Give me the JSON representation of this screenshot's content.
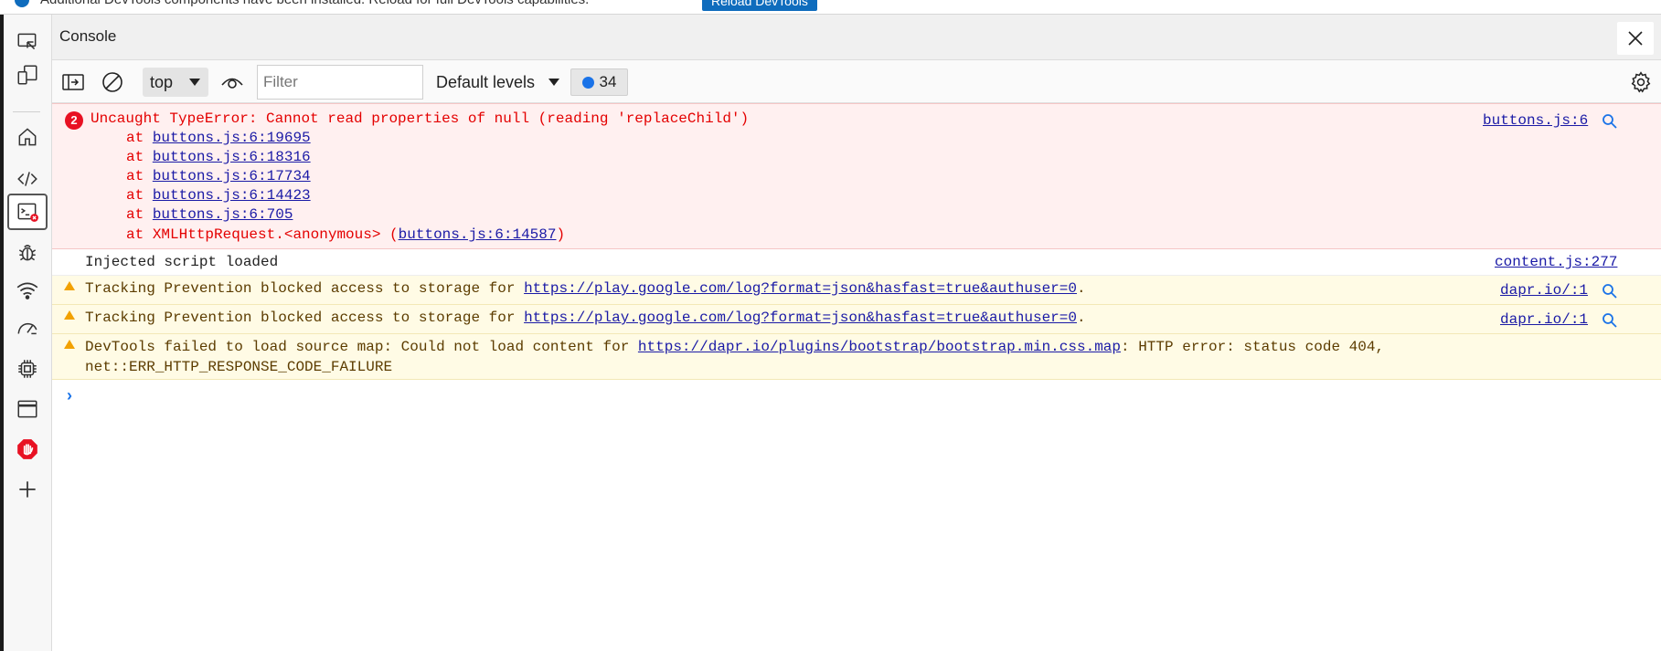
{
  "infobar": {
    "text": "Additional DevTools components have been installed. Reload for full DevTools capabilities.",
    "reload_label": "Reload DevTools"
  },
  "activity_bar": {
    "items": [
      {
        "icon": "inspect-icon"
      },
      {
        "icon": "device-emulation-icon"
      },
      {
        "icon": "home-icon"
      },
      {
        "icon": "elements-icon"
      },
      {
        "icon": "console-icon",
        "active": true,
        "error_badge": true
      },
      {
        "icon": "sources-bug-icon"
      },
      {
        "icon": "network-icon"
      },
      {
        "icon": "performance-icon"
      },
      {
        "icon": "memory-icon"
      },
      {
        "icon": "application-icon"
      },
      {
        "icon": "adblock-icon"
      },
      {
        "icon": "more-tools-plus-icon"
      }
    ]
  },
  "header": {
    "title": "Console"
  },
  "toolbar": {
    "context": "top",
    "filter_placeholder": "Filter",
    "levels": "Default levels",
    "issues_count": "34"
  },
  "messages": {
    "error": {
      "count": "2",
      "text": "Uncaught TypeError: Cannot read properties of null (reading 'replaceChild')",
      "source": "buttons.js:6",
      "at": "at",
      "frames": [
        "buttons.js:6:19695",
        "buttons.js:6:18316",
        "buttons.js:6:17734",
        "buttons.js:6:14423",
        "buttons.js:6:705"
      ],
      "last_frame_prefix": "XMLHttpRequest.<anonymous> (",
      "last_frame_link": "buttons.js:6:14587",
      "last_frame_suffix": ")"
    },
    "info": {
      "text": "Injected script loaded",
      "source": "content.js:277"
    },
    "warn1": {
      "prefix": "Tracking Prevention blocked access to storage for ",
      "link": "https://play.google.com/log?format=json&hasfast=true&authuser=0",
      "suffix": ".",
      "source": "dapr.io/:1"
    },
    "warn2": {
      "prefix": "Tracking Prevention blocked access to storage for ",
      "link": "https://play.google.com/log?format=json&hasfast=true&authuser=0",
      "suffix": ".",
      "source": "dapr.io/:1"
    },
    "warn3": {
      "prefix": "DevTools failed to load source map: Could not load content for ",
      "link": "https://dapr.io/plugins/bootstrap/bootstrap.min.css.map",
      "suffix": ": HTTP error: status code 404,",
      "line2": "net::ERR_HTTP_RESPONSE_CODE_FAILURE"
    }
  },
  "colors": {
    "error": "#e40000",
    "warning_bg": "#fffbe5",
    "link": "#1a1aa6",
    "accent": "#1a73e8"
  }
}
